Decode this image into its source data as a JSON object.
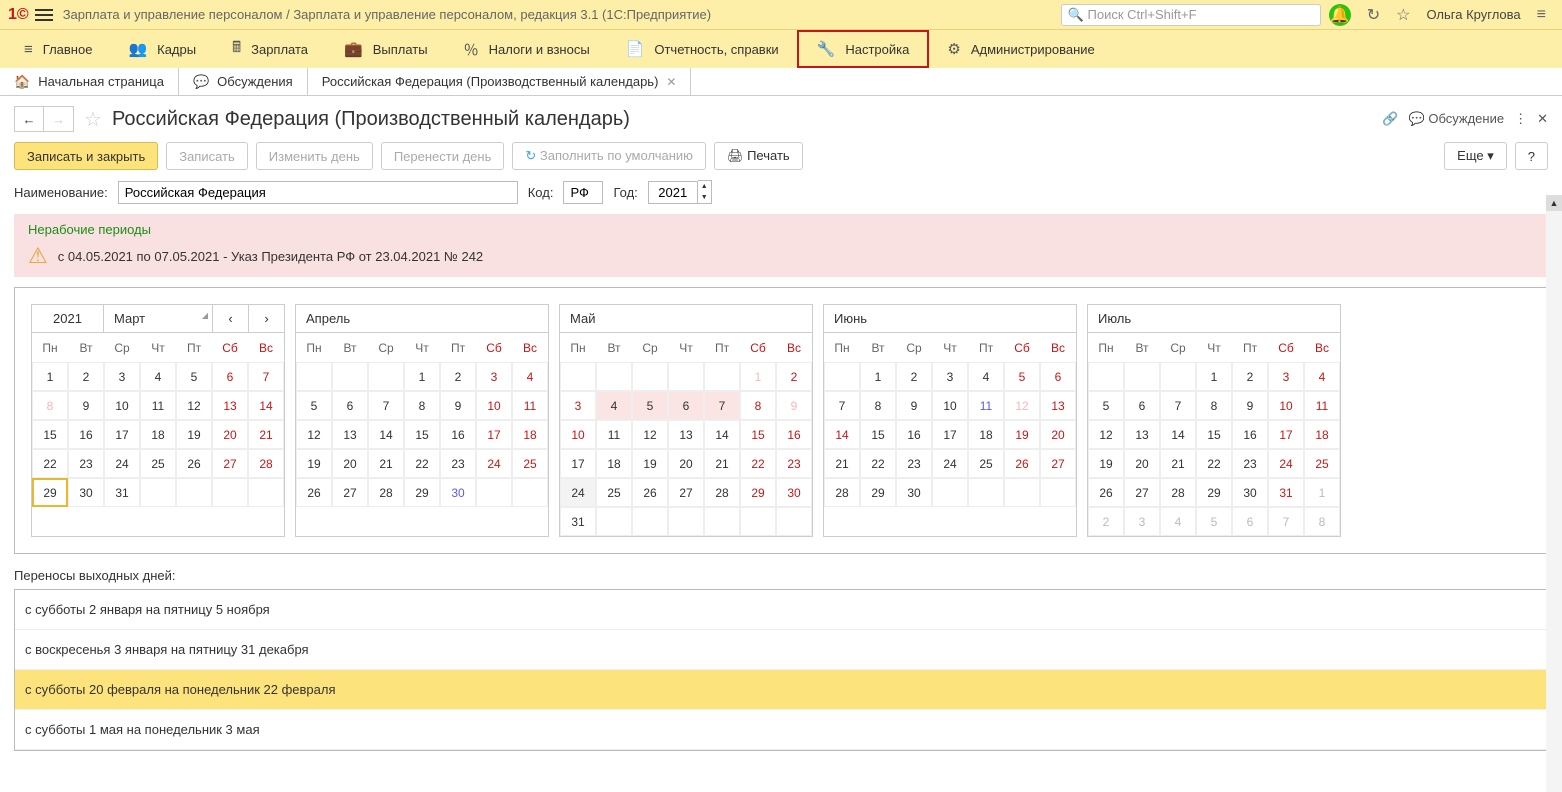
{
  "app_title": "Зарплата и управление персоналом / Зарплата и управление персоналом, редакция 3.1  (1С:Предприятие)",
  "search_placeholder": "Поиск Ctrl+Shift+F",
  "user": "Ольга Круглова",
  "main_menu": [
    "Главное",
    "Кадры",
    "Зарплата",
    "Выплаты",
    "Налоги и взносы",
    "Отчетность, справки",
    "Настройка",
    "Администрирование"
  ],
  "tabs": {
    "home": "Начальная страница",
    "discuss": "Обсуждения",
    "current": "Российская Федерация (Производственный календарь)"
  },
  "page_title": "Российская Федерация (Производственный календарь)",
  "hdr_discussion": "Обсуждение",
  "toolbar": {
    "save_close": "Записать и закрыть",
    "save": "Записать",
    "change_day": "Изменить день",
    "move_day": "Перенести день",
    "fill_default": "Заполнить по умолчанию",
    "print": "Печать",
    "more": "Еще",
    "help": "?"
  },
  "form": {
    "name_label": "Наименование:",
    "name_value": "Российская Федерация",
    "code_label": "Код:",
    "code_value": "РФ",
    "year_label": "Год:",
    "year_value": "2021"
  },
  "notice": {
    "title": "Нерабочие периоды",
    "text": "с 04.05.2021 по 07.05.2021 - Указ Президента РФ от 23.04.2021 № 242"
  },
  "cal_year": "2021",
  "weekdays": [
    "Пн",
    "Вт",
    "Ср",
    "Чт",
    "Пт",
    "Сб",
    "Вс"
  ],
  "months": {
    "mar": {
      "name": "Март",
      "weeks": [
        [
          {
            "d": "1"
          },
          {
            "d": "2"
          },
          {
            "d": "3"
          },
          {
            "d": "4"
          },
          {
            "d": "5"
          },
          {
            "d": "6",
            "c": "wkend"
          },
          {
            "d": "7",
            "c": "wkend"
          }
        ],
        [
          {
            "d": "8",
            "c": "mutedred"
          },
          {
            "d": "9"
          },
          {
            "d": "10"
          },
          {
            "d": "11"
          },
          {
            "d": "12"
          },
          {
            "d": "13",
            "c": "wkend"
          },
          {
            "d": "14",
            "c": "wkend"
          }
        ],
        [
          {
            "d": "15"
          },
          {
            "d": "16"
          },
          {
            "d": "17"
          },
          {
            "d": "18"
          },
          {
            "d": "19"
          },
          {
            "d": "20",
            "c": "wkend"
          },
          {
            "d": "21",
            "c": "wkend"
          }
        ],
        [
          {
            "d": "22"
          },
          {
            "d": "23"
          },
          {
            "d": "24"
          },
          {
            "d": "25"
          },
          {
            "d": "26"
          },
          {
            "d": "27",
            "c": "wkend"
          },
          {
            "d": "28",
            "c": "wkend"
          }
        ],
        [
          {
            "d": "29",
            "c": "today"
          },
          {
            "d": "30"
          },
          {
            "d": "31"
          },
          {
            "d": ""
          },
          {
            "d": ""
          },
          {
            "d": ""
          },
          {
            "d": ""
          }
        ]
      ]
    },
    "apr": {
      "name": "Апрель",
      "weeks": [
        [
          {
            "d": ""
          },
          {
            "d": ""
          },
          {
            "d": ""
          },
          {
            "d": "1"
          },
          {
            "d": "2"
          },
          {
            "d": "3",
            "c": "wkend"
          },
          {
            "d": "4",
            "c": "wkend"
          }
        ],
        [
          {
            "d": "5"
          },
          {
            "d": "6"
          },
          {
            "d": "7"
          },
          {
            "d": "8"
          },
          {
            "d": "9"
          },
          {
            "d": "10",
            "c": "wkend"
          },
          {
            "d": "11",
            "c": "wkend"
          }
        ],
        [
          {
            "d": "12"
          },
          {
            "d": "13"
          },
          {
            "d": "14"
          },
          {
            "d": "15"
          },
          {
            "d": "16"
          },
          {
            "d": "17",
            "c": "wkend"
          },
          {
            "d": "18",
            "c": "wkend"
          }
        ],
        [
          {
            "d": "19"
          },
          {
            "d": "20"
          },
          {
            "d": "21"
          },
          {
            "d": "22"
          },
          {
            "d": "23"
          },
          {
            "d": "24",
            "c": "wkend"
          },
          {
            "d": "25",
            "c": "wkend"
          }
        ],
        [
          {
            "d": "26"
          },
          {
            "d": "27"
          },
          {
            "d": "28"
          },
          {
            "d": "29"
          },
          {
            "d": "30",
            "c": "pre"
          },
          {
            "d": ""
          },
          {
            "d": ""
          }
        ]
      ]
    },
    "may": {
      "name": "Май",
      "weeks": [
        [
          {
            "d": ""
          },
          {
            "d": ""
          },
          {
            "d": ""
          },
          {
            "d": ""
          },
          {
            "d": ""
          },
          {
            "d": "1",
            "c": "mutedred"
          },
          {
            "d": "2",
            "c": "wkend"
          }
        ],
        [
          {
            "d": "3",
            "c": "wkend"
          },
          {
            "d": "4",
            "c": "spec"
          },
          {
            "d": "5",
            "c": "spec"
          },
          {
            "d": "6",
            "c": "spec"
          },
          {
            "d": "7",
            "c": "spec"
          },
          {
            "d": "8",
            "c": "wkend"
          },
          {
            "d": "9",
            "c": "mutedred"
          }
        ],
        [
          {
            "d": "10",
            "c": "wkend"
          },
          {
            "d": "11"
          },
          {
            "d": "12"
          },
          {
            "d": "13"
          },
          {
            "d": "14"
          },
          {
            "d": "15",
            "c": "wkend"
          },
          {
            "d": "16",
            "c": "wkend"
          }
        ],
        [
          {
            "d": "17"
          },
          {
            "d": "18"
          },
          {
            "d": "19"
          },
          {
            "d": "20"
          },
          {
            "d": "21"
          },
          {
            "d": "22",
            "c": "wkend"
          },
          {
            "d": "23",
            "c": "wkend"
          }
        ],
        [
          {
            "d": "24",
            "c": "todaybg"
          },
          {
            "d": "25"
          },
          {
            "d": "26"
          },
          {
            "d": "27"
          },
          {
            "d": "28"
          },
          {
            "d": "29",
            "c": "wkend"
          },
          {
            "d": "30",
            "c": "wkend"
          }
        ],
        [
          {
            "d": "31"
          },
          {
            "d": ""
          },
          {
            "d": ""
          },
          {
            "d": ""
          },
          {
            "d": ""
          },
          {
            "d": ""
          },
          {
            "d": ""
          }
        ]
      ]
    },
    "jun": {
      "name": "Июнь",
      "weeks": [
        [
          {
            "d": ""
          },
          {
            "d": "1"
          },
          {
            "d": "2"
          },
          {
            "d": "3"
          },
          {
            "d": "4"
          },
          {
            "d": "5",
            "c": "wkend"
          },
          {
            "d": "6",
            "c": "wkend"
          }
        ],
        [
          {
            "d": "7"
          },
          {
            "d": "8"
          },
          {
            "d": "9"
          },
          {
            "d": "10"
          },
          {
            "d": "11",
            "c": "pre"
          },
          {
            "d": "12",
            "c": "mutedred"
          },
          {
            "d": "13",
            "c": "wkend"
          }
        ],
        [
          {
            "d": "14",
            "c": "wkend"
          },
          {
            "d": "15"
          },
          {
            "d": "16"
          },
          {
            "d": "17"
          },
          {
            "d": "18"
          },
          {
            "d": "19",
            "c": "wkend"
          },
          {
            "d": "20",
            "c": "wkend"
          }
        ],
        [
          {
            "d": "21"
          },
          {
            "d": "22"
          },
          {
            "d": "23"
          },
          {
            "d": "24"
          },
          {
            "d": "25"
          },
          {
            "d": "26",
            "c": "wkend"
          },
          {
            "d": "27",
            "c": "wkend"
          }
        ],
        [
          {
            "d": "28"
          },
          {
            "d": "29"
          },
          {
            "d": "30"
          },
          {
            "d": ""
          },
          {
            "d": ""
          },
          {
            "d": ""
          },
          {
            "d": ""
          }
        ]
      ]
    },
    "jul": {
      "name": "Июль",
      "weeks": [
        [
          {
            "d": ""
          },
          {
            "d": ""
          },
          {
            "d": ""
          },
          {
            "d": "1"
          },
          {
            "d": "2"
          },
          {
            "d": "3",
            "c": "wkend"
          },
          {
            "d": "4",
            "c": "wkend"
          }
        ],
        [
          {
            "d": "5"
          },
          {
            "d": "6"
          },
          {
            "d": "7"
          },
          {
            "d": "8"
          },
          {
            "d": "9"
          },
          {
            "d": "10",
            "c": "wkend"
          },
          {
            "d": "11",
            "c": "wkend"
          }
        ],
        [
          {
            "d": "12"
          },
          {
            "d": "13"
          },
          {
            "d": "14"
          },
          {
            "d": "15"
          },
          {
            "d": "16"
          },
          {
            "d": "17",
            "c": "wkend"
          },
          {
            "d": "18",
            "c": "wkend"
          }
        ],
        [
          {
            "d": "19"
          },
          {
            "d": "20"
          },
          {
            "d": "21"
          },
          {
            "d": "22"
          },
          {
            "d": "23"
          },
          {
            "d": "24",
            "c": "wkend"
          },
          {
            "d": "25",
            "c": "wkend"
          }
        ],
        [
          {
            "d": "26"
          },
          {
            "d": "27"
          },
          {
            "d": "28"
          },
          {
            "d": "29"
          },
          {
            "d": "30"
          },
          {
            "d": "31",
            "c": "wkend"
          },
          {
            "d": "1",
            "c": "muted"
          }
        ],
        [
          {
            "d": "2",
            "c": "muted"
          },
          {
            "d": "3",
            "c": "muted"
          },
          {
            "d": "4",
            "c": "muted"
          },
          {
            "d": "5",
            "c": "muted"
          },
          {
            "d": "6",
            "c": "muted"
          },
          {
            "d": "7",
            "c": "muted"
          },
          {
            "d": "8",
            "c": "muted"
          }
        ]
      ]
    }
  },
  "transfers_label": "Переносы выходных дней:",
  "transfers": [
    "с субботы 2 января на пятницу 5 ноября",
    "с воскресенья 3 января на пятницу 31 декабря",
    "с субботы 20 февраля на понедельник 22 февраля",
    "с субботы 1 мая на понедельник 3 мая"
  ]
}
